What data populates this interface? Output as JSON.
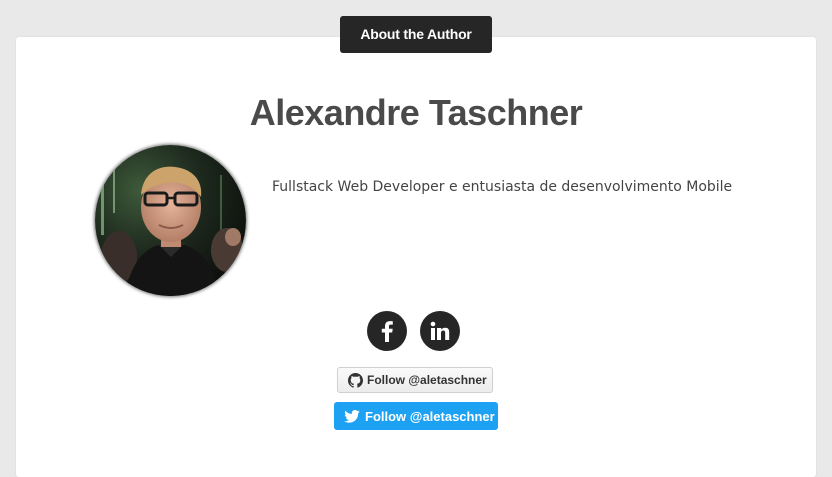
{
  "section": {
    "label": "About the Author"
  },
  "author": {
    "name": "Alexandre Taschner",
    "bio": "Fullstack Web Developer e entusiasta de desenvolvimento Mobile"
  },
  "social": {
    "facebook_icon": "facebook-icon",
    "linkedin_icon": "linkedin-icon",
    "icon_color": "#262626"
  },
  "github": {
    "follow_label": "Follow @aletaschner",
    "icon": "github-icon"
  },
  "twitter": {
    "follow_label": "Follow @aletaschner",
    "icon": "twitter-icon",
    "color": "#1da1f2"
  }
}
